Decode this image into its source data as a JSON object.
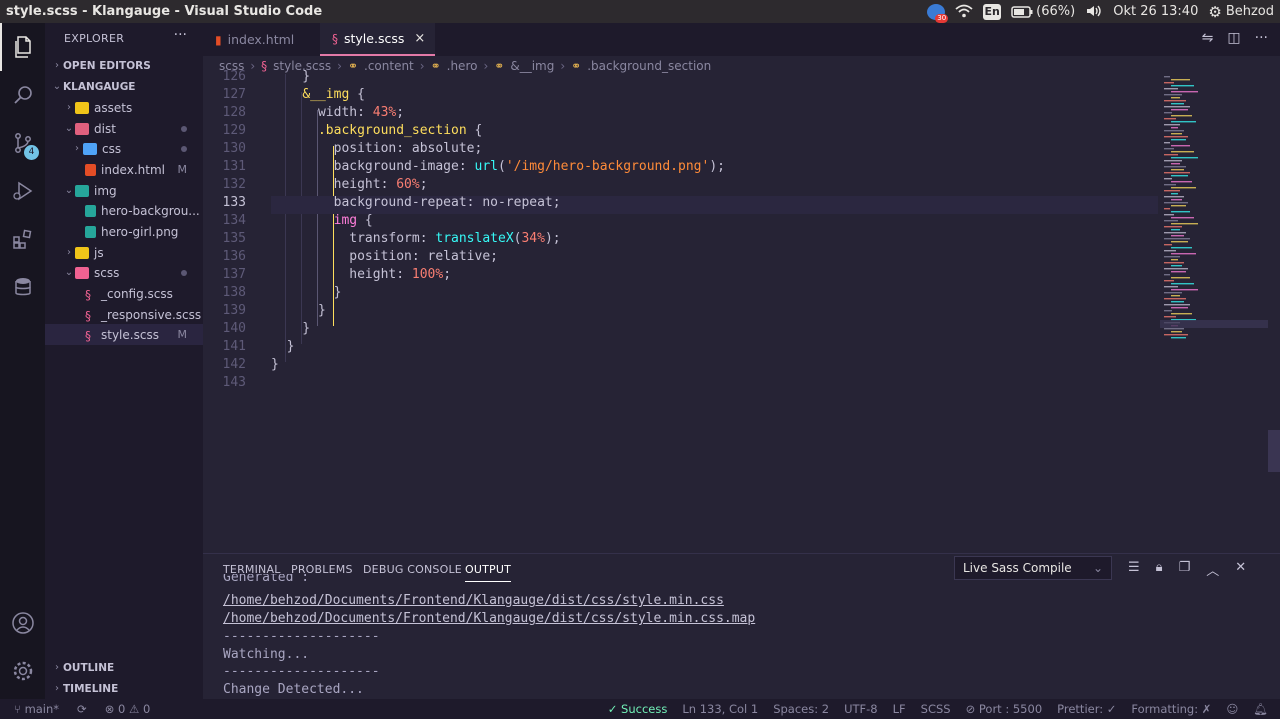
{
  "system": {
    "title": "style.scss - Klangauge - Visual Studio Code",
    "badge": "30",
    "lang": "En",
    "battery": "(66%)",
    "datetime": "Okt 26 13:40",
    "user": "Behzod"
  },
  "activity": {
    "scm_badge": "4"
  },
  "sidebar": {
    "header": "EXPLORER",
    "more": "···",
    "sections": {
      "open_editors": "OPEN EDITORS",
      "project": "KLANGAUGE",
      "outline": "OUTLINE",
      "timeline": "TIMELINE"
    },
    "items": [
      {
        "label": "assets",
        "mark": ""
      },
      {
        "label": "dist",
        "mark": ""
      },
      {
        "label": "css",
        "mark": ""
      },
      {
        "label": "index.html",
        "mark": "M"
      },
      {
        "label": "img",
        "mark": ""
      },
      {
        "label": "hero-backgrou...",
        "mark": ""
      },
      {
        "label": "hero-girl.png",
        "mark": ""
      },
      {
        "label": "js",
        "mark": ""
      },
      {
        "label": "scss",
        "mark": ""
      },
      {
        "label": "_config.scss",
        "mark": ""
      },
      {
        "label": "_responsive.scss",
        "mark": ""
      },
      {
        "label": "style.scss",
        "mark": "M"
      }
    ]
  },
  "tabs": [
    {
      "label": "index.html"
    },
    {
      "label": "style.scss",
      "close": "×"
    }
  ],
  "breadcrumb": {
    "items": [
      "scss",
      "style.scss",
      ".content",
      ".hero",
      "&__img",
      ".background_section"
    ],
    "sep": "›"
  },
  "code": {
    "lines": [
      {
        "n": "126",
        "text": "    }"
      },
      {
        "n": "127",
        "text": "    &__img {"
      },
      {
        "n": "128",
        "text": "      width: 43%;"
      },
      {
        "n": "129",
        "text": "      .background_section {"
      },
      {
        "n": "130",
        "text": "        position: absolute;"
      },
      {
        "n": "131",
        "text": "        background-image: url('/img/hero-background.png');"
      },
      {
        "n": "132",
        "text": "        height: 60%;"
      },
      {
        "n": "133",
        "text": "        background-repeat: no-repeat;"
      },
      {
        "n": "134",
        "text": "        img {"
      },
      {
        "n": "135",
        "text": "          transform: translateX(34%);"
      },
      {
        "n": "136",
        "text": "          position: relative;"
      },
      {
        "n": "137",
        "text": "          height: 100%;"
      },
      {
        "n": "138",
        "text": "        }"
      },
      {
        "n": "139",
        "text": "      }"
      },
      {
        "n": "140",
        "text": "    }"
      },
      {
        "n": "141",
        "text": "  }"
      },
      {
        "n": "142",
        "text": "}"
      },
      {
        "n": "143",
        "text": ""
      }
    ]
  },
  "panel": {
    "tabs": [
      "TERMINAL",
      "PROBLEMS",
      "DEBUG CONSOLE",
      "OUTPUT"
    ],
    "channel": "Live Sass Compile",
    "output": [
      "Generated :",
      "/home/behzod/Documents/Frontend/Klangauge/dist/css/style.min.css",
      "/home/behzod/Documents/Frontend/Klangauge/dist/css/style.min.css.map",
      "--------------------",
      "Watching...",
      "--------------------",
      "Change Detected..."
    ]
  },
  "status": {
    "branch": "main*",
    "errors": "0",
    "warnings": "0",
    "success": "✓ Success",
    "position": "Ln 133, Col 1",
    "spaces": "Spaces: 2",
    "encoding": "UTF-8",
    "eol": "LF",
    "language": "SCSS",
    "port": "⊘ Port : 5500",
    "prettier": "Prettier: ✓",
    "formatting": "Formatting: ✗"
  }
}
